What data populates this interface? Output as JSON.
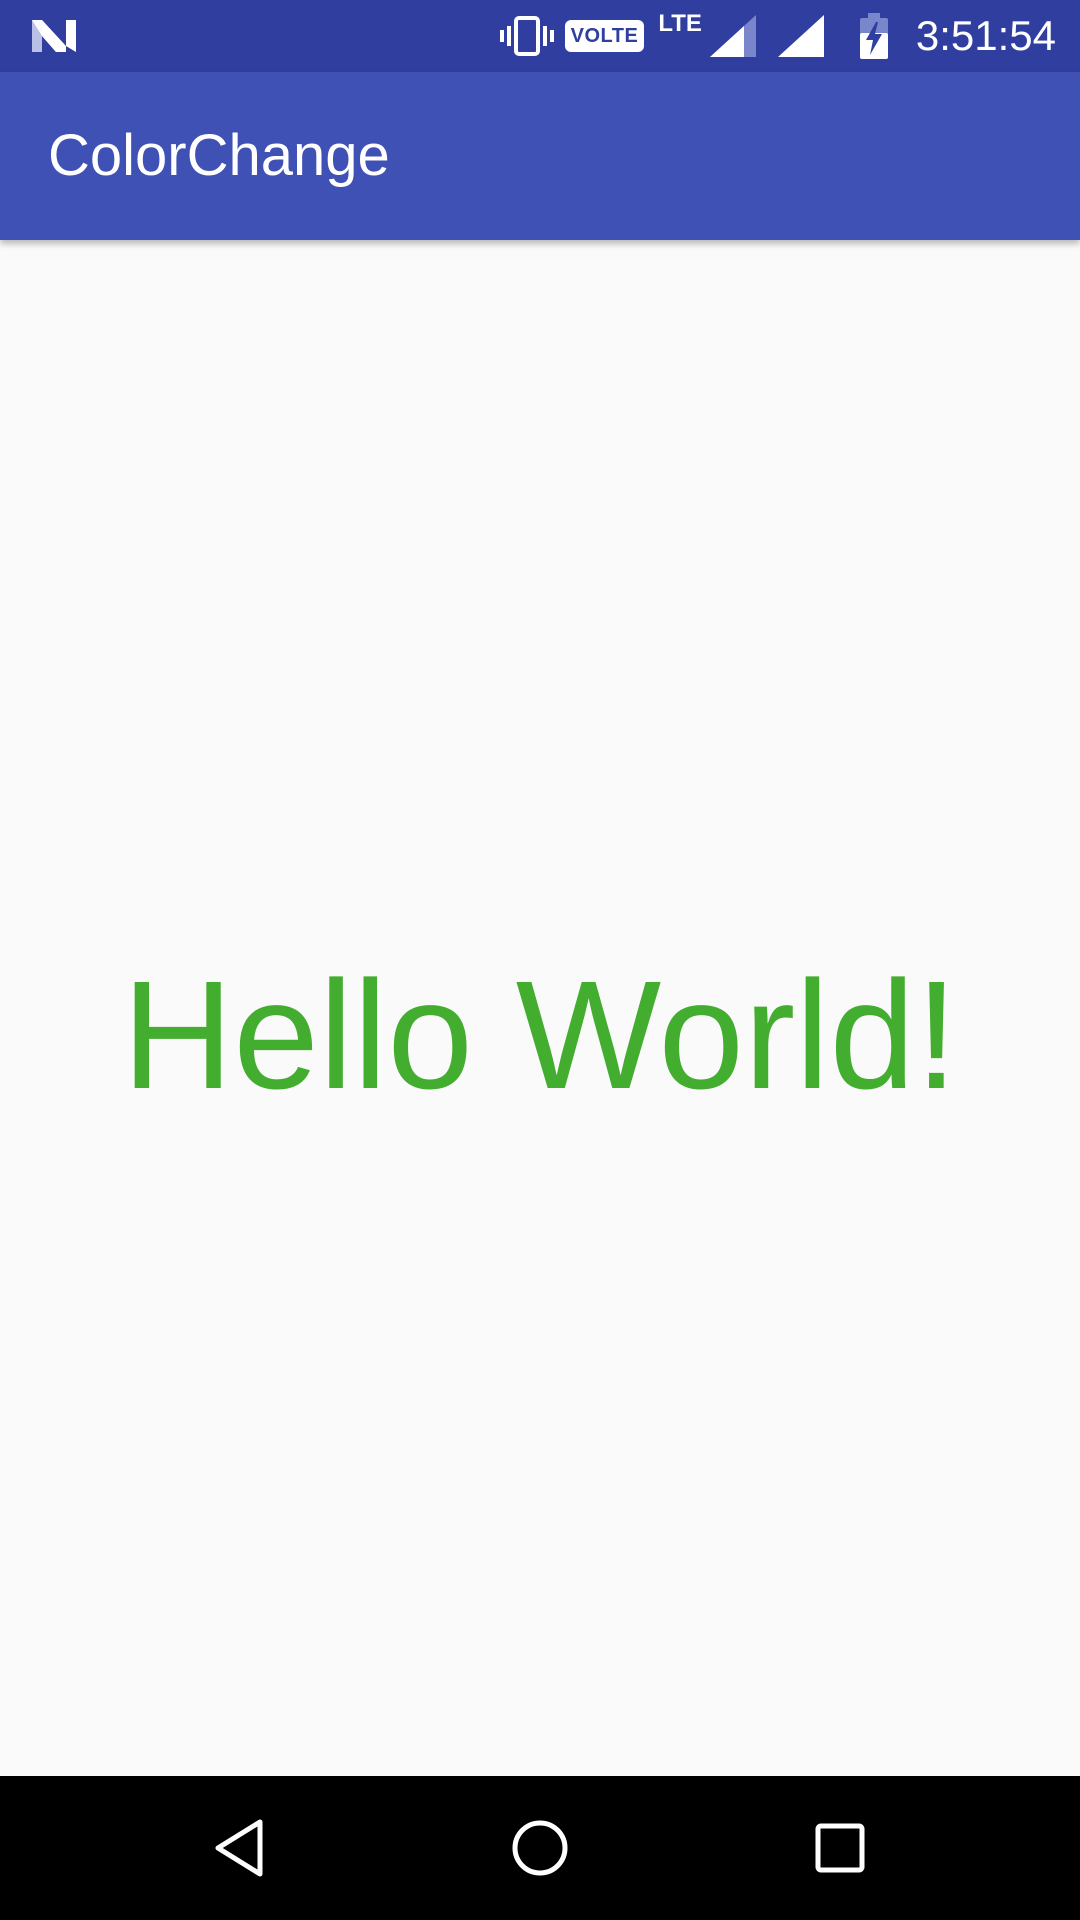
{
  "status_bar": {
    "volte_label": "VOLTE",
    "network_label": "LTE",
    "time": "3:51:54",
    "icons": [
      "n-logo-icon",
      "vibrate-icon",
      "signal-icon",
      "signal-icon",
      "battery-charging-icon"
    ],
    "background_color": "#303f9f"
  },
  "app_bar": {
    "title": "ColorChange",
    "background_color": "#3f51b5"
  },
  "main": {
    "text": "Hello World!",
    "text_color": "#43ad2f"
  },
  "nav_bar": {
    "icons": [
      "back-icon",
      "home-icon",
      "recents-icon"
    ]
  }
}
